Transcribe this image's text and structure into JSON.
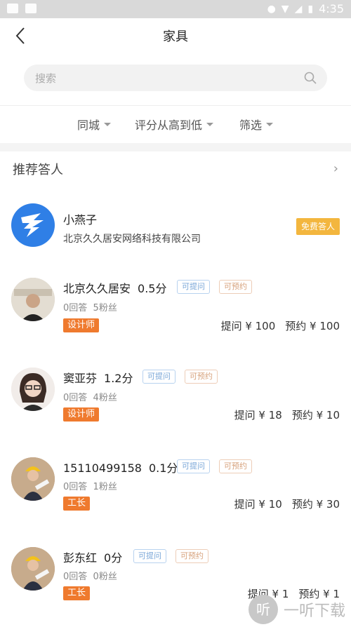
{
  "status_bar": {
    "time": "4:35"
  },
  "header": {
    "title": "家具"
  },
  "search": {
    "placeholder": "搜索"
  },
  "filters": [
    {
      "label": "同城"
    },
    {
      "label": "评分从高到低"
    },
    {
      "label": "筛选"
    }
  ],
  "recommended": {
    "heading": "推荐答人",
    "featured": {
      "name": "小燕子",
      "company": "北京久久居安网络科技有限公司",
      "badge": "免费答人"
    }
  },
  "experts": [
    {
      "name": "北京久久居安",
      "score": "0.5分",
      "tag_ask": "可提问",
      "tag_book": "可预约",
      "answers": "0回答",
      "fans": "5粉丝",
      "role": "设计师",
      "ask_price": "提问 ¥ 100",
      "book_price": "预约 ¥ 100"
    },
    {
      "name": "窦亚芬",
      "score": "1.2分",
      "tag_ask": "可提问",
      "tag_book": "可预约",
      "answers": "0回答",
      "fans": "4粉丝",
      "role": "设计师",
      "ask_price": "提问 ¥ 18",
      "book_price": "预约 ¥ 10"
    },
    {
      "name": "15110499158",
      "score": "0.1分",
      "tag_ask": "可提问",
      "tag_book": "可预约",
      "answers": "0回答",
      "fans": "1粉丝",
      "role": "工长",
      "ask_price": "提问 ¥ 10",
      "book_price": "预约 ¥ 30"
    },
    {
      "name": "彭东红",
      "score": "0分",
      "tag_ask": "可提问",
      "tag_book": "可预约",
      "answers": "0回答",
      "fans": "0粉丝",
      "role": "工长",
      "ask_price": "提问 ¥ 1",
      "book_price": "预约 ¥ 1"
    }
  ],
  "watermark": {
    "logo": "听",
    "text": "一听下载"
  }
}
